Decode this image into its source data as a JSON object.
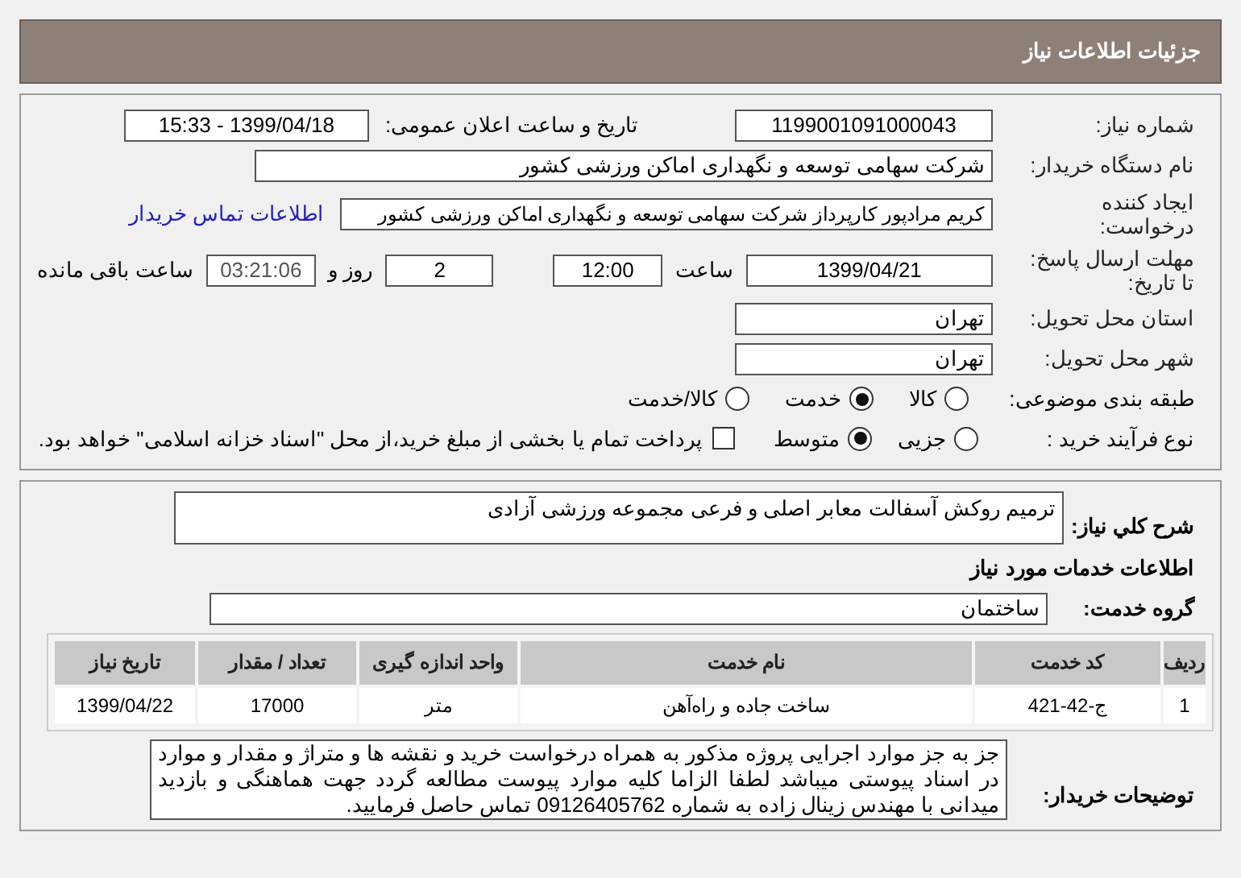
{
  "header": {
    "title": "جزئیات اطلاعات نیاز"
  },
  "need_number": {
    "label": "شماره نیاز:",
    "value": "1199001091000043"
  },
  "announce": {
    "label": "تاریخ و ساعت اعلان عمومی:",
    "value": "1399/04/18 - 15:33"
  },
  "buyer": {
    "label": "نام دستگاه خریدار:",
    "value": "شرکت سهامی توسعه و نگهداری اماکن ورزشی کشور"
  },
  "creator": {
    "label": "ایجاد کننده درخواست:",
    "value": "کریم مرادپور کارپرداز شرکت سهامی توسعه و نگهداری اماکن ورزشی کشور",
    "link": "اطلاعات تماس خریدار"
  },
  "deadline": {
    "label": "مهلت ارسال پاسخ: تا تاریخ:",
    "date": "1399/04/21",
    "time_label": "ساعت",
    "time": "12:00",
    "days": "2",
    "days_label": "روز و",
    "remaining": "03:21:06",
    "remaining_label": "ساعت باقی مانده"
  },
  "province": {
    "label": "استان محل تحویل:",
    "value": "تهران"
  },
  "city": {
    "label": "شهر محل تحویل:",
    "value": "تهران"
  },
  "category": {
    "label": "طبقه بندی موضوعی:",
    "options": [
      {
        "label": "کالا",
        "selected": false
      },
      {
        "label": "خدمت",
        "selected": true
      },
      {
        "label": "کالا/خدمت",
        "selected": false
      }
    ]
  },
  "process": {
    "label": "نوع فرآیند خرید :",
    "options": [
      {
        "label": "جزیی",
        "selected": false
      },
      {
        "label": "متوسط",
        "selected": true
      }
    ],
    "treasury": {
      "checked": false,
      "text": "پرداخت تمام یا بخشی از مبلغ خرید،از محل \"اسناد خزانه اسلامی\" خواهد بود."
    }
  },
  "description": {
    "label": "شرح کلي نیاز:",
    "value": "ترمیم روکش آسفالت معابر اصلی و فرعی مجموعه ورزشی آزادی"
  },
  "services_heading": "اطلاعات خدمات مورد نیاز",
  "service_group": {
    "label": "گروه خدمت:",
    "value": "ساختمان"
  },
  "table": {
    "columns": [
      "ردیف",
      "کد خدمت",
      "نام خدمت",
      "واحد اندازه گیری",
      "تعداد / مقدار",
      "تاریخ نیاز"
    ],
    "rows": [
      [
        "1",
        "ج-42-421",
        "ساخت جاده و راه‌آهن",
        "متر",
        "17000",
        "1399/04/22"
      ]
    ]
  },
  "buyer_notes": {
    "label": "توضیحات خریدار:",
    "value": "جز به جز موارد اجرایی پروژه مذکور به همراه درخواست خرید و نقشه ها و متراژ و مقدار و موارد در اسناد پیوستی میباشد لطفا الزاما کلیه موارد پیوست مطالعه گردد جهت هماهنگی و بازدید میدانی با مهندس زینال زاده به شماره 09126405762 تماس حاصل فرمایید."
  }
}
